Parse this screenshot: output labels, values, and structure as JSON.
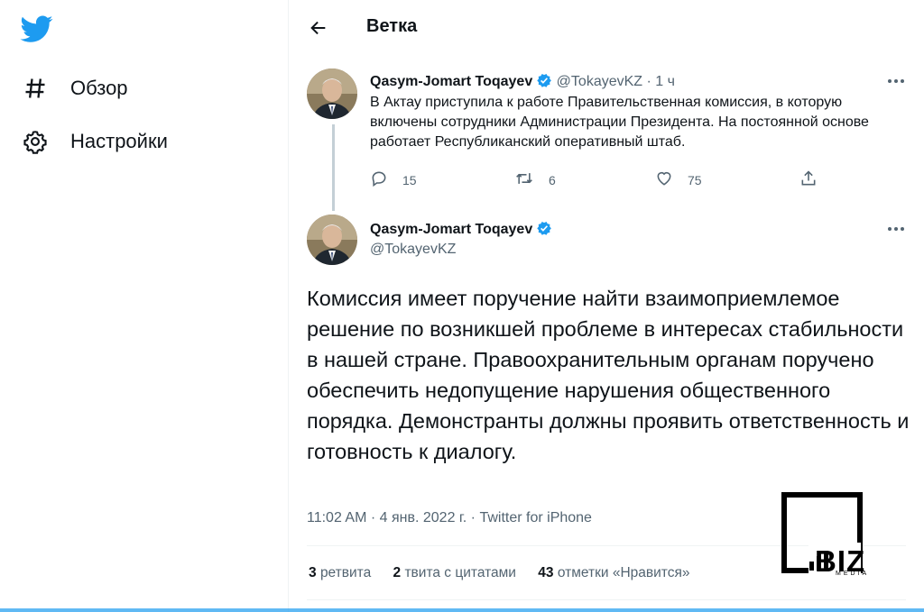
{
  "colors": {
    "accent": "#1d9bf0",
    "text": "#0f1419",
    "muted": "#536471"
  },
  "sidebar": {
    "logo_icon": "twitter-bird-icon",
    "items": [
      {
        "icon": "hashtag-icon",
        "label": "Обзор"
      },
      {
        "icon": "gear-icon",
        "label": "Настройки"
      }
    ]
  },
  "header": {
    "back_icon": "arrow-left-icon",
    "title": "Ветка"
  },
  "tweet1": {
    "name": "Qasym-Jomart Toqayev",
    "handle": "@TokayevKZ",
    "separator": "·",
    "time": "1 ч",
    "text": "В Актау приступила к работе Правительственная комиссия, в которую включены сотрудники Администрации Президента. На постоянной основе работает Республиканский оперативный штаб.",
    "actions": {
      "replies": "15",
      "retweets": "6",
      "likes": "75"
    }
  },
  "tweet2": {
    "name": "Qasym-Jomart Toqayev",
    "handle": "@TokayevKZ",
    "text": "Комиссия имеет поручение найти взаимоприемлемое решение по возникшей проблеме в интересах стабильности в нашей стране. Правоохранительным органам поручено обеспечить недопущение нарушения общественного порядка. Демонстранты должны проявить ответственность и готовность к диалогу.",
    "meta": "11:02 AM · 4 янв. 2022 г. · Twitter for iPhone",
    "stats": {
      "retweets_count": "3",
      "retweets_label": "ретвита",
      "quotes_count": "2",
      "quotes_label": "твита с цитатами",
      "likes_count": "43",
      "likes_label": "отметки «Нравится»"
    }
  },
  "watermark": {
    "text": "BIZ",
    "sub": "MEDIA"
  }
}
